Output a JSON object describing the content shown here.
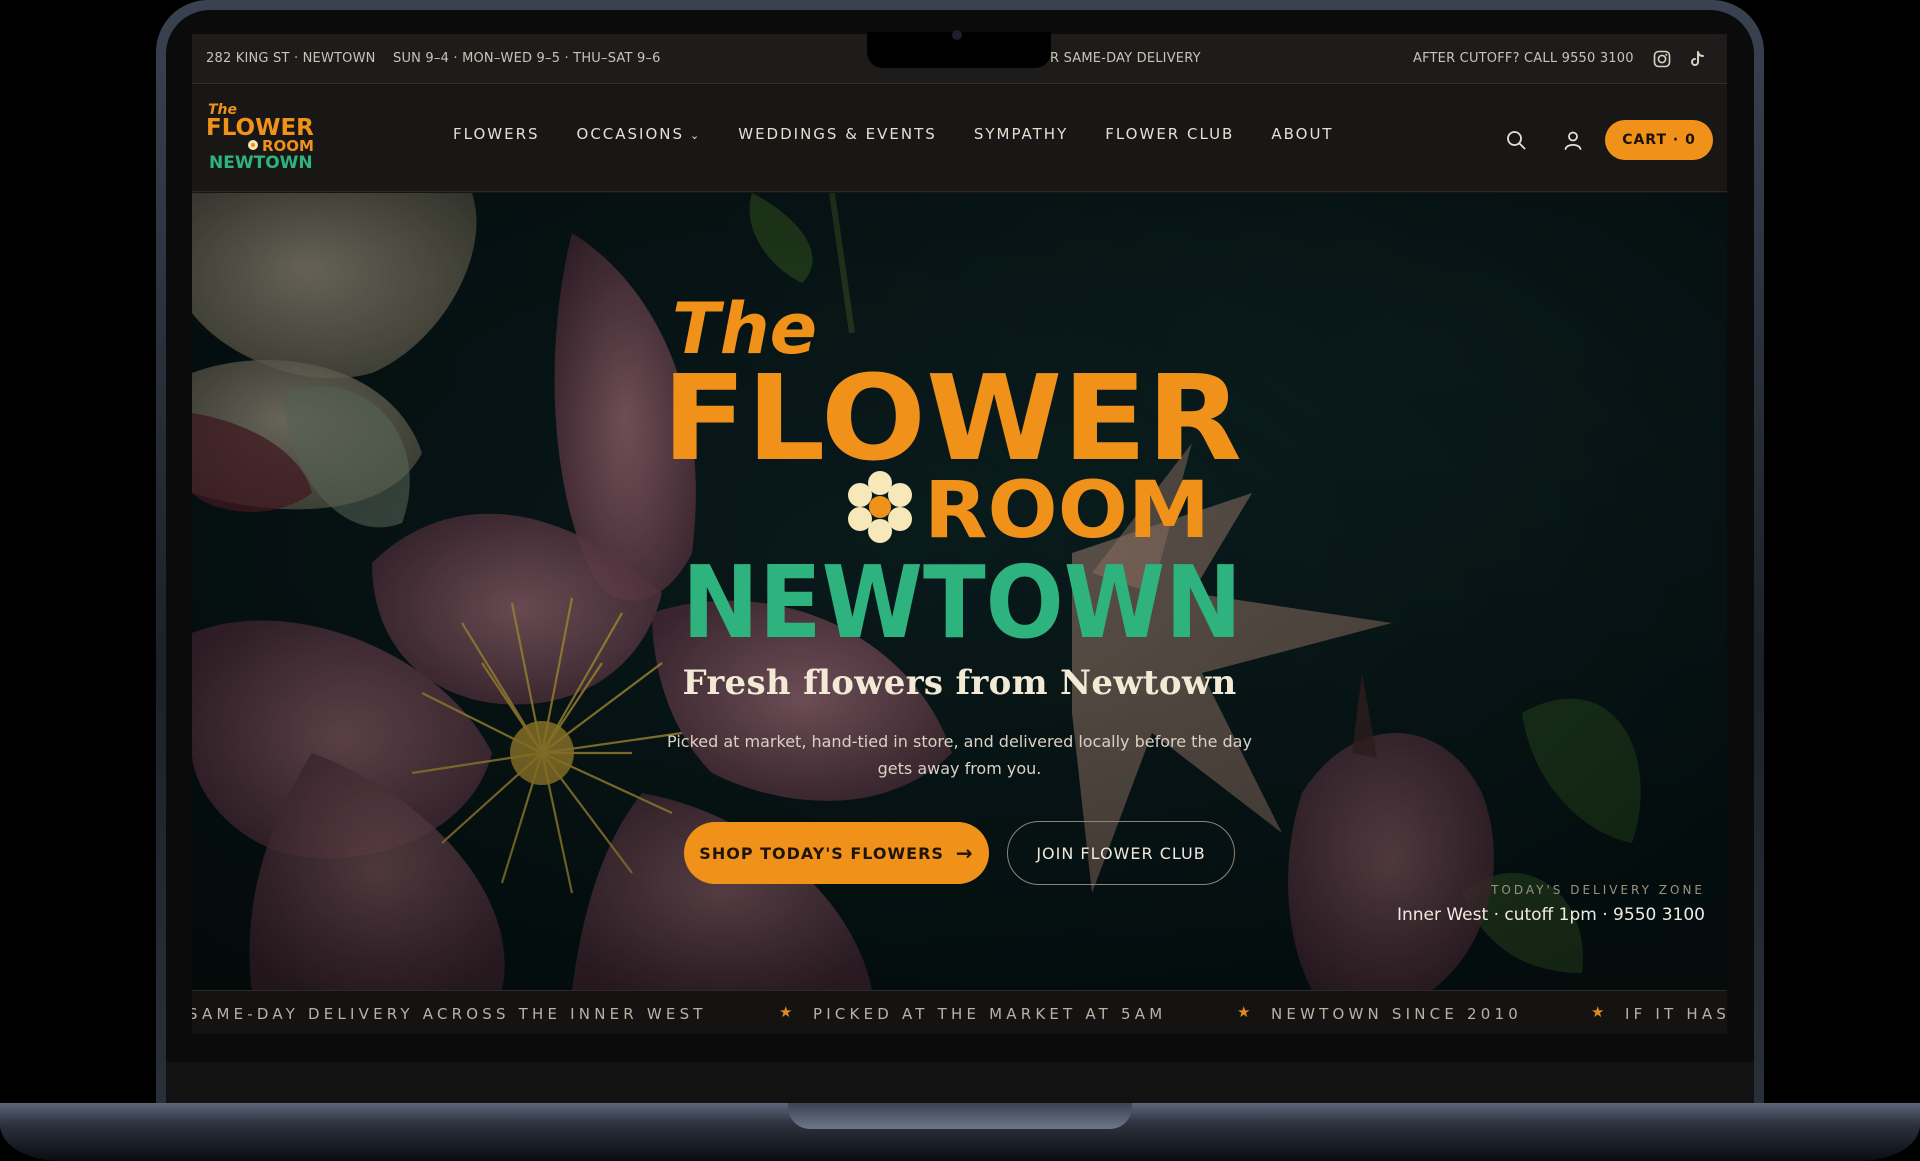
{
  "topbar": {
    "address": "282 KING ST · NEWTOWN",
    "hours": "SUN 9–4 · MON–WED 9–5 · THU–SAT 9–6",
    "delivery_partial": "R SAME-DAY DELIVERY",
    "cutoff": "AFTER CUTOFF? CALL 9550 3100",
    "social_icons": [
      "instagram-icon",
      "tiktok-icon"
    ]
  },
  "logo": {
    "line1": "The",
    "line2": "FLOWER",
    "line3": "ROOM",
    "line4": "NEWTOWN"
  },
  "nav": {
    "items": [
      {
        "label": "FLOWERS"
      },
      {
        "label": "OCCASIONS",
        "has_dropdown": true
      },
      {
        "label": "WEDDINGS & EVENTS"
      },
      {
        "label": "SYMPATHY"
      },
      {
        "label": "FLOWER CLUB"
      },
      {
        "label": "ABOUT"
      }
    ],
    "cart_label": "CART · 0",
    "icons": [
      "search-icon",
      "account-icon"
    ]
  },
  "hero": {
    "title_line1": "The",
    "title_line2": "FLOWER",
    "title_line3": "ROOM",
    "title_line4": "NEWTOWN",
    "tagline": "Fresh flowers from Newtown",
    "description": "Picked at market, hand-tied in store, and delivered locally before the day gets away from you.",
    "primary_cta": "SHOP TODAY'S FLOWERS",
    "primary_cta_arrow": "→",
    "secondary_cta": "JOIN FLOWER CLUB",
    "delivery_zone_label": "TODAY'S DELIVERY ZONE",
    "delivery_zone_value": "Inner West · cutoff 1pm · 9550 3100"
  },
  "ticker": {
    "items": [
      "SAME-DAY DELIVERY ACROSS THE INNER WEST",
      "PICKED AT THE MARKET AT 5AM",
      "NEWTOWN SINCE 2010",
      "IF IT HAS"
    ],
    "separator": "★"
  },
  "colors": {
    "accent_orange": "#f0921a",
    "accent_green": "#2fb37e",
    "cream": "#f3ead6",
    "hero_bg": "#0b1f21"
  }
}
